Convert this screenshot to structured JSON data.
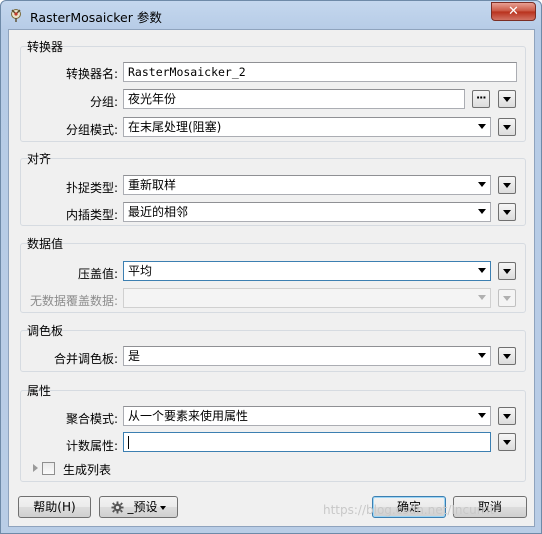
{
  "window": {
    "title": "RasterMosaicker 参数",
    "close_glyph": "✕",
    "icon": "transformer-icon"
  },
  "groups": {
    "transformer": {
      "title": "转换器",
      "name_label": "转换器名:",
      "name_value": "RasterMosaicker_2",
      "group_label": "分组:",
      "group_value": "夜光年份",
      "group_mode_label": "分组模式:",
      "group_mode_value": "在末尾处理(阻塞)"
    },
    "align": {
      "title": "对齐",
      "snap_label": "扑捉类型:",
      "snap_value": "重新取样",
      "interp_label": "内插类型:",
      "interp_value": "最近的相邻"
    },
    "data_values": {
      "title": "数据值",
      "overlap_label": "压盖值:",
      "overlap_value": "平均",
      "nodata_overlap_label": "无数据覆盖数据:",
      "nodata_overlap_value": ""
    },
    "palette": {
      "title": "调色板",
      "merge_label": "合并调色板:",
      "merge_value": "是"
    },
    "attributes": {
      "title": "属性",
      "aggregate_label": "聚合模式:",
      "aggregate_value": "从一个要素来使用属性",
      "count_label": "计数属性:",
      "count_value": "",
      "generate_list_label": "生成列表"
    }
  },
  "footer": {
    "help_label": "帮助(H)",
    "presets_label": "_预设",
    "ok_label": "确定",
    "cancel_label": "取消"
  },
  "watermark": "https://blog.csdn.net/Incurrit",
  "colors": {
    "accent_border": "#3c7fb1",
    "close_red": "#c8533f",
    "title_bar": "#b6cbe6"
  }
}
